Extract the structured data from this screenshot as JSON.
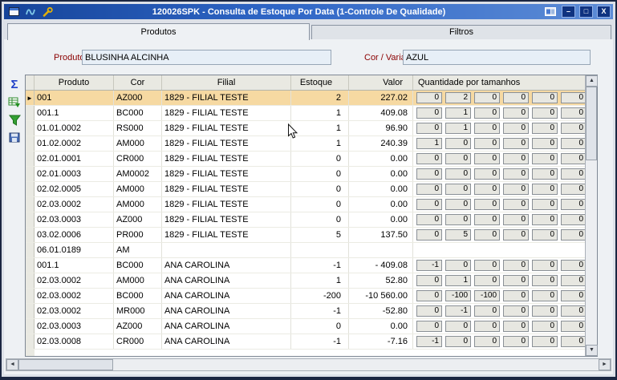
{
  "window": {
    "title": "120026SPK - Consulta de Estoque Por Data (1-Controle De Qualidade)",
    "minimize_glyph": "–",
    "maximize_glyph": "□",
    "close_glyph": "X"
  },
  "tabs": {
    "produtos": "Produtos",
    "filtros": "Filtros"
  },
  "form": {
    "produto_label": "Produto",
    "produto_value": "BLUSINHA ALCINHA",
    "cor_label": "Cor / Variante",
    "cor_value": "AZUL"
  },
  "toolbar": {
    "sum_glyph": "Σ"
  },
  "icons": {
    "up_arrow": "▲",
    "down_arrow": "▼",
    "left_arrow": "◄",
    "right_arrow": "►",
    "row_marker": "►"
  },
  "colors": {
    "titlebar_blue": "#2f66c6",
    "selected_row": "#f6d9a2",
    "label_red": "#8b0000"
  },
  "grid": {
    "headers": {
      "produto": "Produto",
      "cor": "Cor",
      "filial": "Filial",
      "estoque": "Estoque",
      "valor": "Valor",
      "tamanhos": "Quantidade por tamanhos"
    },
    "rows": [
      {
        "produto": "001",
        "cor": "AZ000",
        "filial": "1829 - FILIAL TESTE",
        "estoque": "2",
        "valor": "227.02",
        "qty": [
          "0",
          "2",
          "0",
          "0",
          "0",
          "0"
        ],
        "selected": true
      },
      {
        "produto": "001.1",
        "cor": "BC000",
        "filial": "1829 - FILIAL TESTE",
        "estoque": "1",
        "valor": "409.08",
        "qty": [
          "0",
          "1",
          "0",
          "0",
          "0",
          "0"
        ]
      },
      {
        "produto": "01.01.0002",
        "cor": "RS000",
        "filial": "1829 - FILIAL TESTE",
        "estoque": "1",
        "valor": "96.90",
        "qty": [
          "0",
          "1",
          "0",
          "0",
          "0",
          "0"
        ]
      },
      {
        "produto": "01.02.0002",
        "cor": "AM000",
        "filial": "1829 - FILIAL TESTE",
        "estoque": "1",
        "valor": "240.39",
        "qty": [
          "1",
          "0",
          "0",
          "0",
          "0",
          "0"
        ]
      },
      {
        "produto": "02.01.0001",
        "cor": "CR000",
        "filial": "1829 - FILIAL TESTE",
        "estoque": "0",
        "valor": "0.00",
        "qty": [
          "0",
          "0",
          "0",
          "0",
          "0",
          "0"
        ]
      },
      {
        "produto": "02.01.0003",
        "cor": "AM0002",
        "filial": "1829 - FILIAL TESTE",
        "estoque": "0",
        "valor": "0.00",
        "qty": [
          "0",
          "0",
          "0",
          "0",
          "0",
          "0"
        ]
      },
      {
        "produto": "02.02.0005",
        "cor": "AM000",
        "filial": "1829 - FILIAL TESTE",
        "estoque": "0",
        "valor": "0.00",
        "qty": [
          "0",
          "0",
          "0",
          "0",
          "0",
          "0"
        ]
      },
      {
        "produto": "02.03.0002",
        "cor": "AM000",
        "filial": "1829 - FILIAL TESTE",
        "estoque": "0",
        "valor": "0.00",
        "qty": [
          "0",
          "0",
          "0",
          "0",
          "0",
          "0"
        ]
      },
      {
        "produto": "02.03.0003",
        "cor": "AZ000",
        "filial": "1829 - FILIAL TESTE",
        "estoque": "0",
        "valor": "0.00",
        "qty": [
          "0",
          "0",
          "0",
          "0",
          "0",
          "0"
        ]
      },
      {
        "produto": "03.02.0006",
        "cor": "PR000",
        "filial": "1829 - FILIAL TESTE",
        "estoque": "5",
        "valor": "137.50",
        "qty": [
          "0",
          "5",
          "0",
          "0",
          "0",
          "0"
        ]
      },
      {
        "produto": "06.01.0189",
        "cor": "AM",
        "filial": "",
        "estoque": "",
        "valor": "",
        "qty": []
      },
      {
        "produto": "001.1",
        "cor": "BC000",
        "filial": "ANA CAROLINA",
        "estoque": "-1",
        "valor": "- 409.08",
        "qty": [
          "-1",
          "0",
          "0",
          "0",
          "0",
          "0"
        ]
      },
      {
        "produto": "02.03.0002",
        "cor": "AM000",
        "filial": "ANA CAROLINA",
        "estoque": "1",
        "valor": "52.80",
        "qty": [
          "0",
          "1",
          "0",
          "0",
          "0",
          "0"
        ]
      },
      {
        "produto": "02.03.0002",
        "cor": "BC000",
        "filial": "ANA CAROLINA",
        "estoque": "-200",
        "valor": "-10 560.00",
        "qty": [
          "0",
          "-100",
          "-100",
          "0",
          "0",
          "0"
        ]
      },
      {
        "produto": "02.03.0002",
        "cor": "MR000",
        "filial": "ANA CAROLINA",
        "estoque": "-1",
        "valor": "-52.80",
        "qty": [
          "0",
          "-1",
          "0",
          "0",
          "0",
          "0"
        ]
      },
      {
        "produto": "02.03.0003",
        "cor": "AZ000",
        "filial": "ANA CAROLINA",
        "estoque": "0",
        "valor": "0.00",
        "qty": [
          "0",
          "0",
          "0",
          "0",
          "0",
          "0"
        ]
      },
      {
        "produto": "02.03.0008",
        "cor": "CR000",
        "filial": "ANA CAROLINA",
        "estoque": "-1",
        "valor": "-7.16",
        "qty": [
          "-1",
          "0",
          "0",
          "0",
          "0",
          "0"
        ]
      }
    ]
  }
}
